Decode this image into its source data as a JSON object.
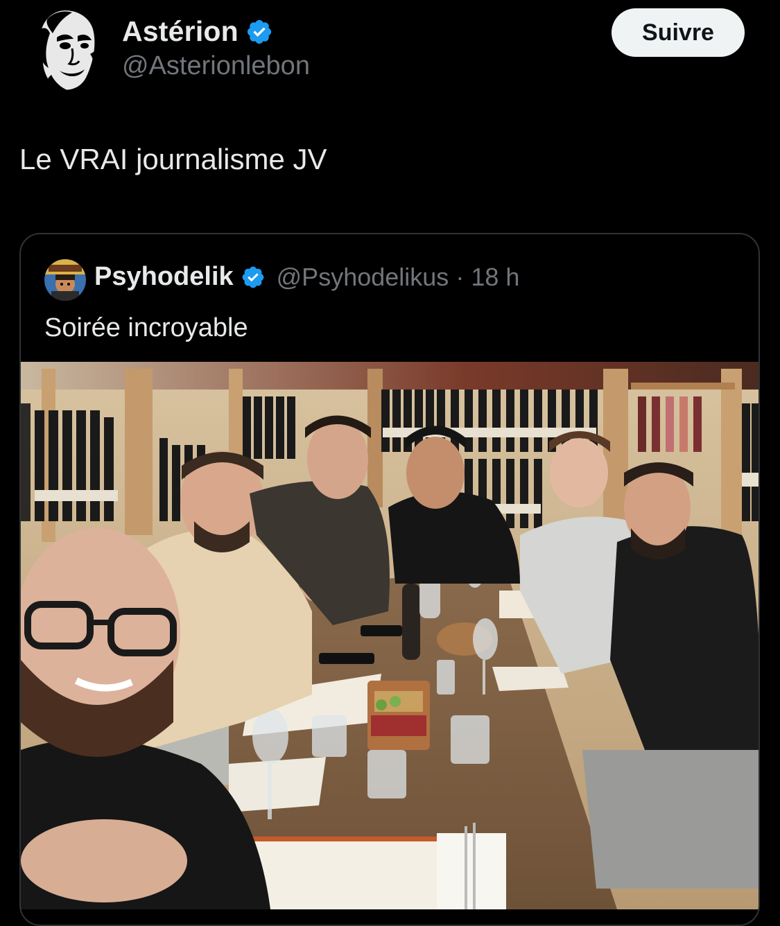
{
  "author": {
    "name": "Astérion",
    "handle": "@Asterionlebon",
    "verified": true
  },
  "follow_button": {
    "label": "Suivre"
  },
  "tweet": {
    "text": "Le VRAI journalisme JV"
  },
  "quoted_tweet": {
    "author_name": "Psyhodelik",
    "handle": "@Psyhodelikus",
    "separator": "·",
    "time": "18 h",
    "verified": true,
    "text": "Soirée incroyable",
    "photo": {
      "description_icons": [
        "wine-bottle-icon"
      ]
    }
  },
  "colors": {
    "background": "#000000",
    "text_primary": "#e7e9ea",
    "text_secondary": "#71767b",
    "verified_blue": "#1d9bf0",
    "border": "#2f3336",
    "follow_bg": "#eff3f4"
  }
}
